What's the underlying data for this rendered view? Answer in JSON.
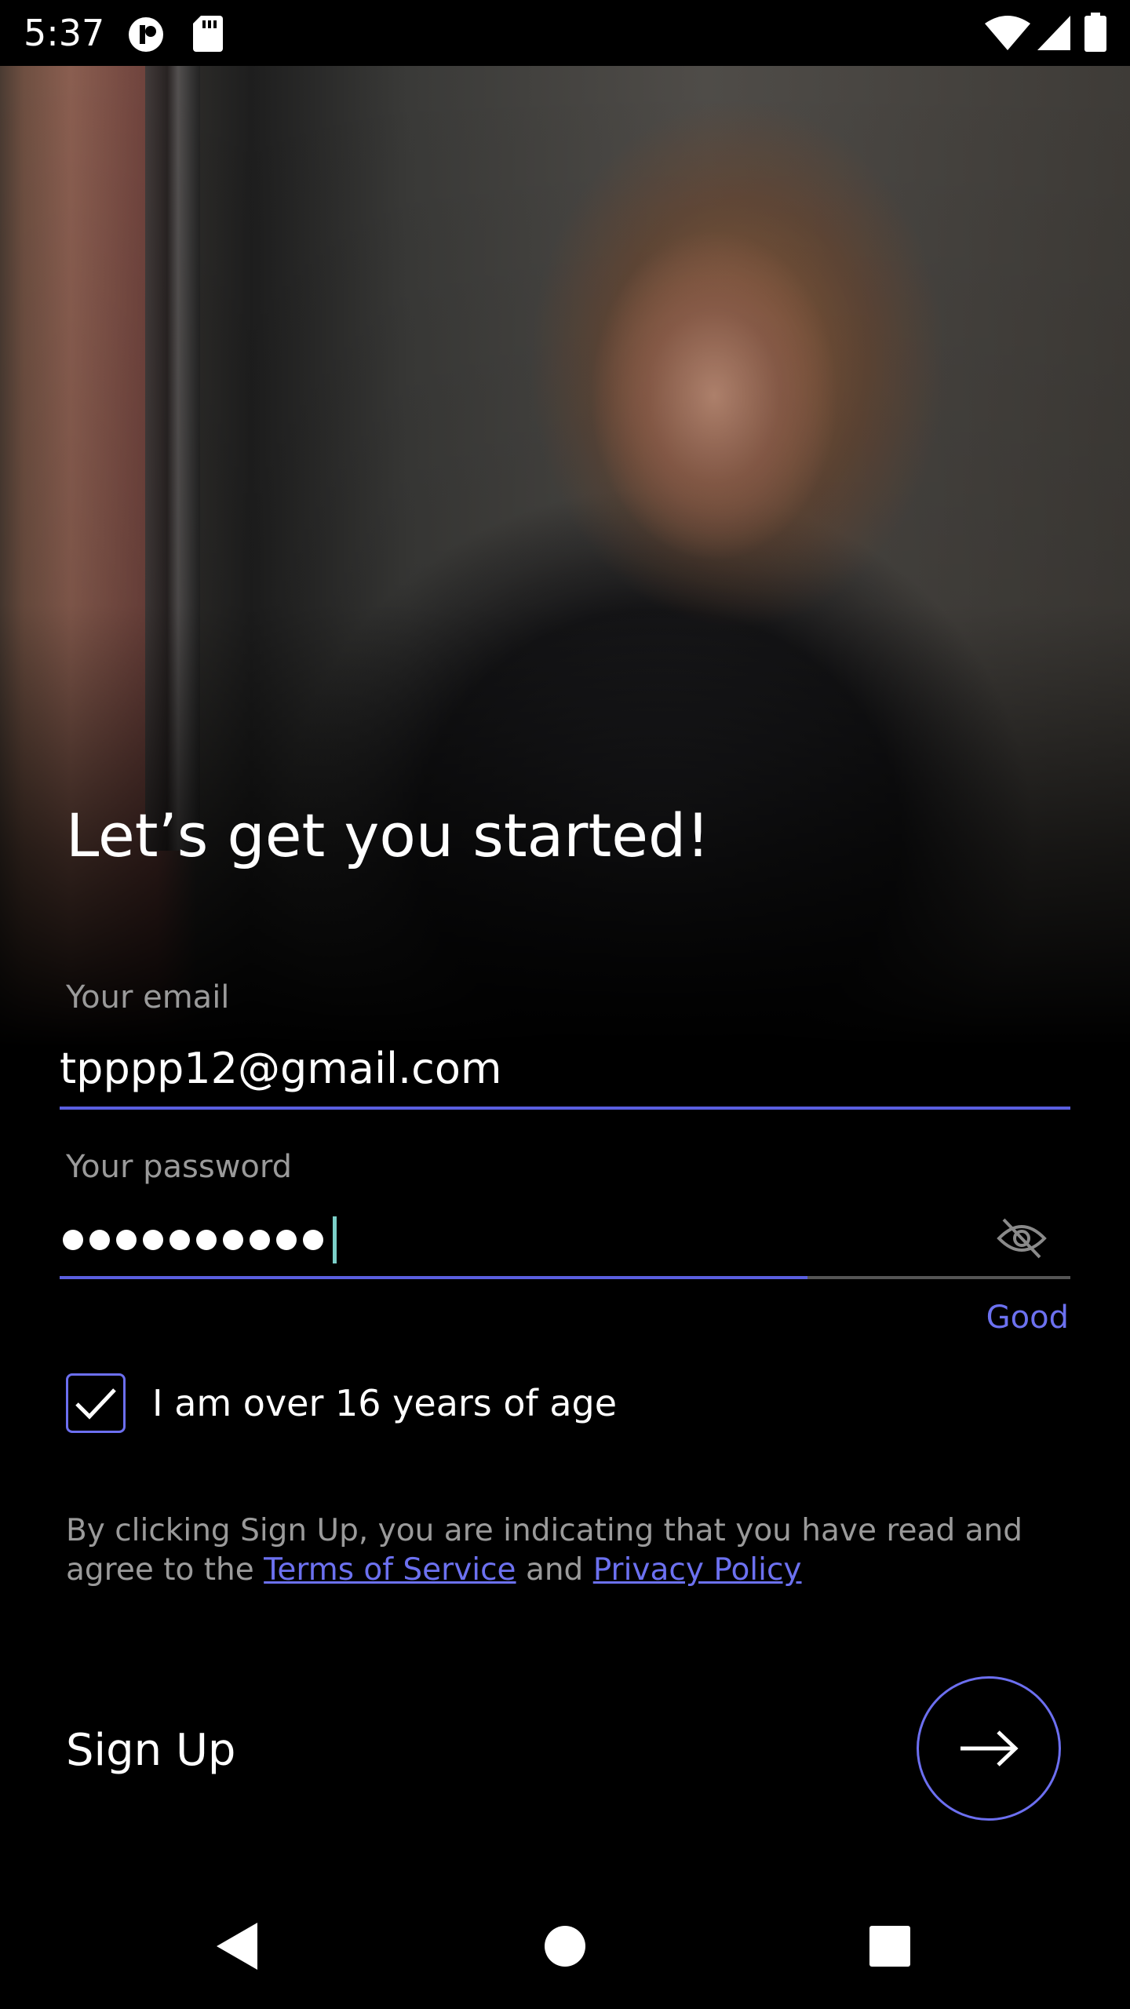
{
  "status_bar": {
    "time": "5:37",
    "left_icons": [
      "app-notification-icon",
      "sd-card-icon"
    ],
    "right_icons": [
      "wifi-icon",
      "cell-signal-icon",
      "battery-icon"
    ]
  },
  "hero": {
    "image": "woman-looking-at-phone-photo"
  },
  "title": "Let’s get you started!",
  "email": {
    "label": "Your email",
    "value": "tpppp12@gmail.com"
  },
  "password": {
    "label": "Your password",
    "masked_length": 10,
    "visibility_icon": "eye-off-icon",
    "strength_label": "Good",
    "strength_fraction": 0.74
  },
  "age_checkbox": {
    "checked": true,
    "label": "I am over 16 years of age"
  },
  "legal": {
    "prefix": "By clicking Sign Up, you are indicating that you have read and agree to the ",
    "terms_link": "Terms of Service",
    "conjunction": " and ",
    "privacy_link": "Privacy Policy"
  },
  "signup": {
    "label": "Sign Up",
    "button_icon": "arrow-right-icon"
  },
  "nav_bar": {
    "icons": [
      "back-icon",
      "home-icon",
      "recents-icon"
    ]
  },
  "colors": {
    "accent": "#6c71f0",
    "underline": "#5a5fe0",
    "caret": "#7bd0c9",
    "muted_text": "#9a9a9a",
    "background": "#000000"
  }
}
